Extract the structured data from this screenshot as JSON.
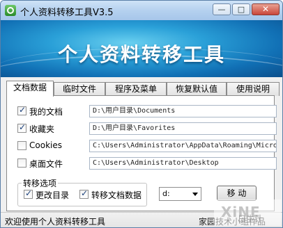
{
  "window": {
    "title": "个人资料转移工具V3.5"
  },
  "caption_buttons": {
    "minimize": "—",
    "maximize": "□",
    "close": "✕"
  },
  "banner": {
    "title": "个人资料转移工具"
  },
  "tabs": [
    {
      "label": "文档数据",
      "active": true
    },
    {
      "label": "临时文件",
      "active": false
    },
    {
      "label": "程序及菜单",
      "active": false
    },
    {
      "label": "恢复默认值",
      "active": false
    },
    {
      "label": "使用说明",
      "active": false
    }
  ],
  "items": [
    {
      "label": "我的文档",
      "checked": true,
      "path": "D:\\用户目录\\Documents"
    },
    {
      "label": "收藏夹",
      "checked": true,
      "path": "D:\\用户目录\\Favorites"
    },
    {
      "label": "Cookies",
      "checked": false,
      "path": "C:\\Users\\Administrator\\AppData\\Roaming\\Micro"
    },
    {
      "label": "桌面文件",
      "checked": false,
      "path": "C:\\Users\\Administrator\\Desktop"
    }
  ],
  "transfer_options": {
    "legend": "转移选项",
    "change_dir": {
      "label": "更改目录",
      "checked": true
    },
    "transfer_docs": {
      "label": "转移文档数据",
      "checked": true
    }
  },
  "drive_select": {
    "value": "d:"
  },
  "move_button": {
    "label": "移 动"
  },
  "status": {
    "left": "欢迎使用个人资料转移工具",
    "right": "家园技术小组作品"
  },
  "watermark": {
    "text": "XiNE",
    "sub": "日生计"
  }
}
